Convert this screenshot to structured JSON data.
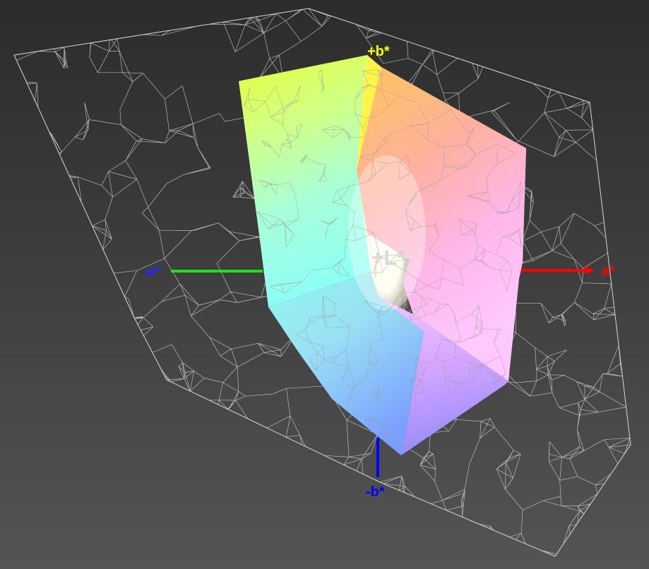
{
  "labels": {
    "plus_b": "+b*",
    "minus_b": "-b*",
    "plus_a": "a*",
    "minus_a": "-a*",
    "plus_l": "+L*"
  },
  "colors": {
    "plus_b": "#ffff00",
    "minus_b": "#0000ff",
    "plus_a": "#ff0000",
    "minus_a": "#2222ff",
    "plus_l": "#cfcfcf",
    "a_axis_positive": "#ff0000",
    "a_axis_negative": "#22dd22",
    "b_axis_negative": "#0000ff",
    "wireframe": "#d8d8d8"
  }
}
